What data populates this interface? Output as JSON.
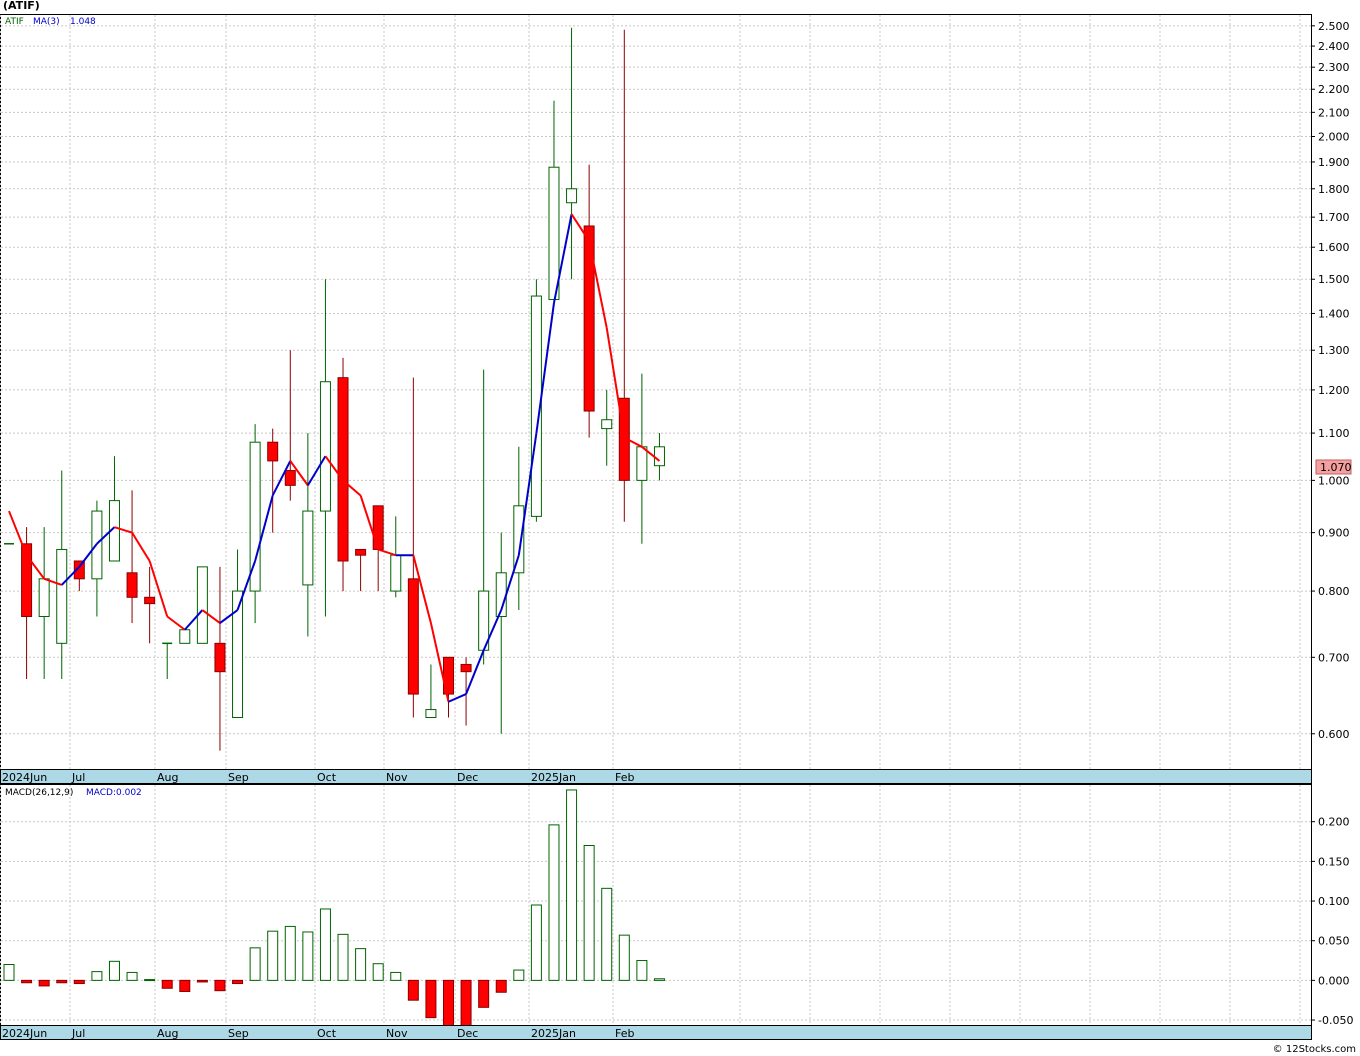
{
  "header": {
    "ticker_label": "(ATIF)"
  },
  "legend_price": {
    "symbol": "ATIF",
    "ma_label": "MA(3)",
    "ma_value": "1.048"
  },
  "legend_macd": {
    "label": "MACD(26,12,9)",
    "value_label": "MACD:0.002"
  },
  "current_price_label": "1.070",
  "footer": "© 12Stocks.com",
  "colors": {
    "up": "#006400",
    "down": "#8b0000",
    "down_fill": "#ff0000",
    "ma_up": "#0000cc",
    "ma_down": "#ff0000",
    "axis_band": "#add8e6",
    "grid": "#c8c8c8"
  },
  "chart_data": [
    {
      "type": "candlestick",
      "title": "",
      "scale": "log",
      "ylim": [
        0.56,
        2.55
      ],
      "y_ticks": [
        "0.600",
        "0.700",
        "0.800",
        "0.900",
        "1.000",
        "1.100",
        "1.200",
        "1.300",
        "1.400",
        "1.500",
        "1.600",
        "1.700",
        "1.800",
        "1.900",
        "2.000",
        "2.100",
        "2.200",
        "2.300",
        "2.400",
        "2.500"
      ],
      "x_labels": [
        "2024Jun",
        "Jul",
        "Aug",
        "Sep",
        "Oct",
        "Nov",
        "Dec",
        "2025Jan",
        "Feb"
      ],
      "candles": [
        {
          "o": 0.88,
          "h": 0.88,
          "l": 0.88,
          "c": 0.88
        },
        {
          "o": 0.88,
          "h": 0.91,
          "l": 0.67,
          "c": 0.76
        },
        {
          "o": 0.76,
          "h": 0.91,
          "l": 0.67,
          "c": 0.82
        },
        {
          "o": 0.72,
          "h": 1.02,
          "l": 0.67,
          "c": 0.87
        },
        {
          "o": 0.85,
          "h": 0.85,
          "l": 0.8,
          "c": 0.82
        },
        {
          "o": 0.82,
          "h": 0.96,
          "l": 0.76,
          "c": 0.94
        },
        {
          "o": 0.85,
          "h": 1.05,
          "l": 0.85,
          "c": 0.96
        },
        {
          "o": 0.83,
          "h": 0.98,
          "l": 0.75,
          "c": 0.79
        },
        {
          "o": 0.79,
          "h": 0.84,
          "l": 0.72,
          "c": 0.78
        },
        {
          "o": 0.72,
          "h": 0.72,
          "l": 0.67,
          "c": 0.72
        },
        {
          "o": 0.72,
          "h": 0.74,
          "l": 0.72,
          "c": 0.74
        },
        {
          "o": 0.72,
          "h": 0.84,
          "l": 0.72,
          "c": 0.84
        },
        {
          "o": 0.72,
          "h": 0.84,
          "l": 0.58,
          "c": 0.68
        },
        {
          "o": 0.62,
          "h": 0.87,
          "l": 0.62,
          "c": 0.8
        },
        {
          "o": 0.8,
          "h": 1.12,
          "l": 0.75,
          "c": 1.08
        },
        {
          "o": 1.08,
          "h": 1.11,
          "l": 0.9,
          "c": 1.04
        },
        {
          "o": 1.02,
          "h": 1.3,
          "l": 0.96,
          "c": 0.99
        },
        {
          "o": 0.81,
          "h": 1.1,
          "l": 0.73,
          "c": 0.94
        },
        {
          "o": 0.94,
          "h": 1.5,
          "l": 0.76,
          "c": 1.22
        },
        {
          "o": 1.23,
          "h": 1.28,
          "l": 0.8,
          "c": 0.85
        },
        {
          "o": 0.87,
          "h": 0.87,
          "l": 0.8,
          "c": 0.86
        },
        {
          "o": 0.95,
          "h": 0.95,
          "l": 0.8,
          "c": 0.87
        },
        {
          "o": 0.8,
          "h": 0.93,
          "l": 0.79,
          "c": 0.86
        },
        {
          "o": 0.82,
          "h": 1.23,
          "l": 0.62,
          "c": 0.65
        },
        {
          "o": 0.62,
          "h": 0.69,
          "l": 0.62,
          "c": 0.63
        },
        {
          "o": 0.7,
          "h": 0.7,
          "l": 0.62,
          "c": 0.65
        },
        {
          "o": 0.69,
          "h": 0.7,
          "l": 0.61,
          "c": 0.68
        },
        {
          "o": 0.71,
          "h": 1.25,
          "l": 0.69,
          "c": 0.8
        },
        {
          "o": 0.76,
          "h": 0.9,
          "l": 0.6,
          "c": 0.83
        },
        {
          "o": 0.83,
          "h": 1.07,
          "l": 0.77,
          "c": 0.95
        },
        {
          "o": 0.93,
          "h": 1.5,
          "l": 0.92,
          "c": 1.45
        },
        {
          "o": 1.44,
          "h": 2.15,
          "l": 1.44,
          "c": 1.88
        },
        {
          "o": 1.75,
          "h": 2.49,
          "l": 1.5,
          "c": 1.8
        },
        {
          "o": 1.67,
          "h": 1.89,
          "l": 1.09,
          "c": 1.15
        },
        {
          "o": 1.11,
          "h": 1.2,
          "l": 1.03,
          "c": 1.13
        },
        {
          "o": 1.18,
          "h": 2.48,
          "l": 0.92,
          "c": 1.0
        },
        {
          "o": 1.0,
          "h": 1.24,
          "l": 0.88,
          "c": 1.07
        },
        {
          "o": 1.03,
          "h": 1.1,
          "l": 1.0,
          "c": 1.07
        }
      ],
      "ma": [
        0.94,
        0.86,
        0.82,
        0.81,
        0.84,
        0.88,
        0.91,
        0.9,
        0.85,
        0.76,
        0.74,
        0.77,
        0.75,
        0.77,
        0.85,
        0.97,
        1.04,
        0.99,
        1.05,
        1.0,
        0.97,
        0.87,
        0.86,
        0.86,
        0.75,
        0.64,
        0.65,
        0.71,
        0.77,
        0.86,
        1.1,
        1.43,
        1.71,
        1.62,
        1.36,
        1.09,
        1.07,
        1.04
      ]
    },
    {
      "type": "bar",
      "title": "",
      "ylim": [
        -0.055,
        0.245
      ],
      "y_ticks": [
        "-0.050",
        "0.000",
        "0.050",
        "0.100",
        "0.150",
        "0.200"
      ],
      "x_labels": [
        "2024Jun",
        "Jul",
        "Aug",
        "Sep",
        "Oct",
        "Nov",
        "Dec",
        "2025Jan",
        "Feb"
      ],
      "values": [
        0.02,
        -0.003,
        -0.007,
        -0.003,
        -0.004,
        0.011,
        0.024,
        0.01,
        0.001,
        -0.01,
        -0.014,
        -0.002,
        -0.013,
        -0.004,
        0.041,
        0.062,
        0.068,
        0.061,
        0.09,
        0.058,
        0.04,
        0.021,
        0.01,
        -0.025,
        -0.047,
        -0.065,
        -0.059,
        -0.034,
        -0.015,
        0.013,
        0.095,
        0.196,
        0.24,
        0.17,
        0.116,
        0.057,
        0.025,
        0.002
      ]
    }
  ]
}
